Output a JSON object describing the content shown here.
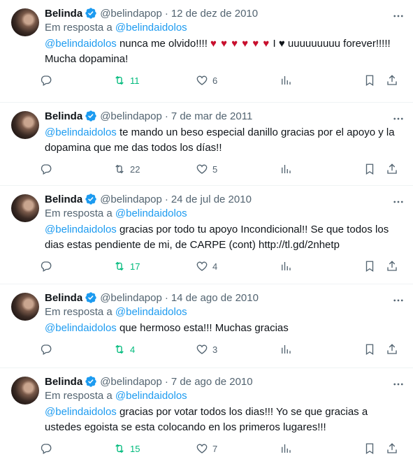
{
  "tweets": [
    {
      "name": "Belinda",
      "handle": "@belindapop",
      "sep": "·",
      "date": "12 de dez de 2010",
      "reply_prefix": "Em resposta a",
      "reply_handle": "@belindaidolos",
      "mention": "@belindaidolos",
      "text": " nunca me olvido!!!! ",
      "hearts": "♥ ♥ ♥ ♥ ♥ ♥",
      "text_after": " I ♥ uuuuuuuuu forever!!!!! Mucha dopamina!",
      "retweets": "11",
      "retweeted": true,
      "likes": "6"
    },
    {
      "name": "Belinda",
      "handle": "@belindapop",
      "sep": "·",
      "date": "7 de mar de 2011",
      "mention": "@belindaidolos",
      "text": " te mando un beso especial  danillo gracias por el apoyo y la dopamina que me das todos los días!!",
      "retweets": "22",
      "retweeted": false,
      "likes": "5"
    },
    {
      "name": "Belinda",
      "handle": "@belindapop",
      "sep": "·",
      "date": "24 de jul de 2010",
      "reply_prefix": "Em resposta a",
      "reply_handle": "@belindaidolos",
      "mention": "@belindaidolos",
      "text": " gracias por todo tu apoyo Incondicional!!  Se que todos los dias estas pendiente de mi, de CARPE (cont) http://tl.gd/2nhetp",
      "retweets": "17",
      "retweeted": true,
      "likes": "4"
    },
    {
      "name": "Belinda",
      "handle": "@belindapop",
      "sep": "·",
      "date": "14 de ago de 2010",
      "reply_prefix": "Em resposta a",
      "reply_handle": "@belindaidolos",
      "mention": "@belindaidolos",
      "text": " que hermoso esta!!! Muchas gracias",
      "retweets": "4",
      "retweeted": true,
      "likes": "3"
    },
    {
      "name": "Belinda",
      "handle": "@belindapop",
      "sep": "·",
      "date": "7 de ago de 2010",
      "reply_prefix": "Em resposta a",
      "reply_handle": "@belindaidolos",
      "mention": "@belindaidolos",
      "text": " gracias por votar todos los dias!!! Yo se que gracias a ustedes egoista se esta colocando en los primeros lugares!!!",
      "retweets": "15",
      "retweeted": true,
      "likes": "7"
    }
  ],
  "colors": {
    "link": "#1d9bf0",
    "muted": "#536471",
    "retweet_active": "#00ba7c",
    "heart_emoji": "#c8102e",
    "verified": "#1d9bf0"
  },
  "icons": [
    "verified-badge-icon",
    "more-icon",
    "reply-icon",
    "retweet-icon",
    "like-icon",
    "views-icon",
    "bookmark-icon",
    "share-icon"
  ]
}
